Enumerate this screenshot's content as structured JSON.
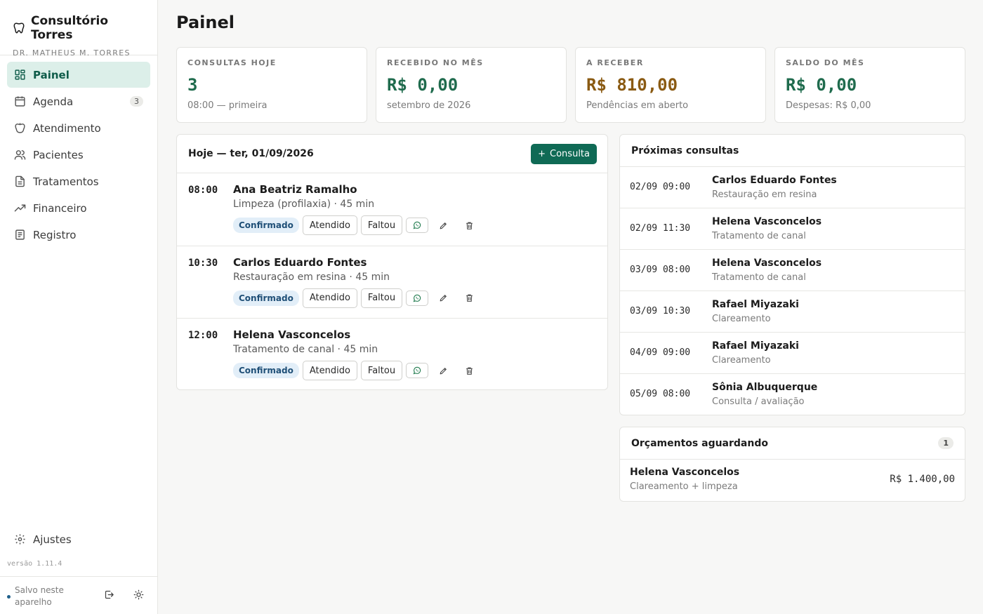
{
  "app": {
    "title": "Consultório Torres",
    "subtitle": "DR. MATHEUS M. TORRES",
    "version": "versão 1.11.4",
    "saved_status": "Salvo neste aparelho"
  },
  "sidebar": {
    "items": [
      {
        "label": "Painel",
        "icon": "dashboard-icon",
        "active": true
      },
      {
        "label": "Agenda",
        "icon": "calendar-icon",
        "badge": "3"
      },
      {
        "label": "Atendimento",
        "icon": "tooth-icon"
      },
      {
        "label": "Pacientes",
        "icon": "users-icon"
      },
      {
        "label": "Tratamentos",
        "icon": "document-icon"
      },
      {
        "label": "Financeiro",
        "icon": "trending-up-icon"
      },
      {
        "label": "Registro",
        "icon": "log-icon"
      }
    ],
    "settings_label": "Ajustes"
  },
  "page": {
    "title": "Painel"
  },
  "stats": [
    {
      "label": "CONSULTAS HOJE",
      "value": "3",
      "sub": "08:00 — primeira",
      "color": "#1f6b4d"
    },
    {
      "label": "RECEBIDO NO MÊS",
      "value": "R$ 0,00",
      "sub": "setembro de 2026",
      "color": "#1f6b4d"
    },
    {
      "label": "A RECEBER",
      "value": "R$ 810,00",
      "sub": "Pendências em aberto",
      "color": "#8a5a12"
    },
    {
      "label": "SALDO DO MÊS",
      "value": "R$ 0,00",
      "sub": "Despesas: R$ 0,00",
      "color": "#1f6b4d"
    }
  ],
  "today": {
    "title": "Hoje — ter, 01/09/2026",
    "add_button": "Consulta",
    "appointments": [
      {
        "time": "08:00",
        "patient": "Ana Beatriz Ramalho",
        "desc": "Limpeza (profilaxia) · 45 min",
        "status": "Confirmado"
      },
      {
        "time": "10:30",
        "patient": "Carlos Eduardo Fontes",
        "desc": "Restauração em resina · 45 min",
        "status": "Confirmado"
      },
      {
        "time": "12:00",
        "patient": "Helena Vasconcelos",
        "desc": "Tratamento de canal · 45 min",
        "status": "Confirmado"
      }
    ],
    "attended_label": "Atendido",
    "missed_label": "Faltou"
  },
  "upcoming": {
    "title": "Próximas consultas",
    "items": [
      {
        "when": "02/09 09:00",
        "patient": "Carlos Eduardo Fontes",
        "desc": "Restauração em resina"
      },
      {
        "when": "02/09 11:30",
        "patient": "Helena Vasconcelos",
        "desc": "Tratamento de canal"
      },
      {
        "when": "03/09 08:00",
        "patient": "Helena Vasconcelos",
        "desc": "Tratamento de canal"
      },
      {
        "when": "03/09 10:30",
        "patient": "Rafael Miyazaki",
        "desc": "Clareamento"
      },
      {
        "when": "04/09 09:00",
        "patient": "Rafael Miyazaki",
        "desc": "Clareamento"
      },
      {
        "when": "05/09 08:00",
        "patient": "Sônia Albuquerque",
        "desc": "Consulta / avaliação"
      }
    ]
  },
  "budgets": {
    "title": "Orçamentos aguardando",
    "count": "1",
    "items": [
      {
        "patient": "Helena Vasconcelos",
        "desc": "Clareamento + limpeza",
        "value": "R$ 1.400,00"
      }
    ]
  }
}
